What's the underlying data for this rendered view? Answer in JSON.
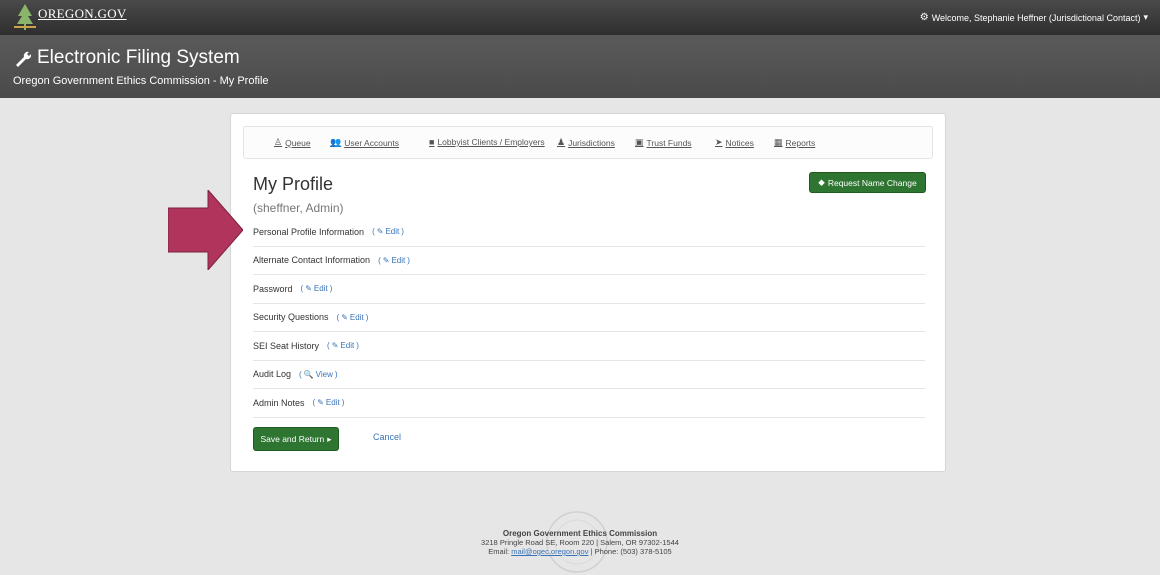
{
  "topbar": {
    "logo_text": "OREGON.GOV",
    "welcome": "Welcome, Stephanie Heffner (Jurisdictional Contact)"
  },
  "header": {
    "title": "Electronic Filing System",
    "subtitle": "Oregon Government Ethics Commission - My Profile"
  },
  "nav": [
    {
      "label": "Queue",
      "icon": "queue-icon"
    },
    {
      "label": "User Accounts",
      "icon": "users-icon"
    },
    {
      "label": "Lobbyist Clients / Employers",
      "icon": "briefcase-icon"
    },
    {
      "label": "Jurisdictions",
      "icon": "jurisdiction-icon"
    },
    {
      "label": "Trust Funds",
      "icon": "money-icon"
    },
    {
      "label": "Notices",
      "icon": "send-icon"
    },
    {
      "label": "Reports",
      "icon": "table-icon"
    }
  ],
  "profile": {
    "title": "My Profile",
    "subtitle": "(sheffner, Admin)",
    "request_button": "Request Name Change"
  },
  "sections": [
    {
      "label": "Personal Profile Information",
      "action": "Edit"
    },
    {
      "label": "Alternate Contact Information",
      "action": "Edit"
    },
    {
      "label": "Password",
      "action": "Edit"
    },
    {
      "label": "Security Questions",
      "action": "Edit"
    },
    {
      "label": "SEI Seat History",
      "action": "Edit"
    },
    {
      "label": "Audit Log",
      "action": "View"
    },
    {
      "label": "Admin Notes",
      "action": "Edit"
    }
  ],
  "actions": {
    "save": "Save and Return",
    "cancel": "Cancel"
  },
  "footer": {
    "org": "Oregon Government Ethics Commission",
    "address": "3218 Pringle Road SE, Room 220 | Salem, OR 97302-1544",
    "email_prefix": "Email: ",
    "email": "mail@ogec.oregon.gov",
    "phone": " | Phone: (503) 378-5105"
  },
  "colors": {
    "accent_green": "#2d7530",
    "link_blue": "#3a73b8",
    "arrow": "#b0345c"
  }
}
